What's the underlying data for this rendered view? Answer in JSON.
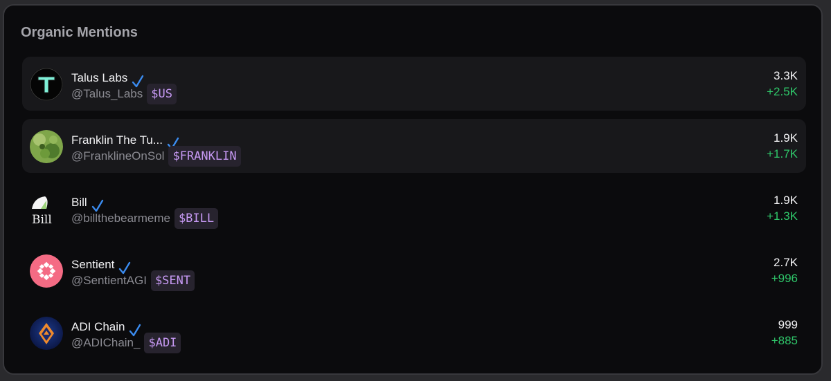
{
  "panel": {
    "title": "Organic Mentions"
  },
  "mentions": [
    {
      "name": "Talus Labs",
      "handle": "@Talus_Labs",
      "ticker": "$US",
      "count": "3.3K",
      "delta": "+2.5K",
      "avatar_icon": "talus-logo"
    },
    {
      "name": "Franklin The Tu...",
      "handle": "@FranklineOnSol",
      "ticker": "$FRANKLIN",
      "count": "1.9K",
      "delta": "+1.7K",
      "avatar_icon": "turtle-photo"
    },
    {
      "name": "Bill",
      "handle": "@billthebearmeme",
      "ticker": "$BILL",
      "count": "1.9K",
      "delta": "+1.3K",
      "avatar_icon": "bill-logo",
      "avatar_text": "Bill"
    },
    {
      "name": "Sentient",
      "handle": "@SentientAGI",
      "ticker": "$SENT",
      "count": "2.7K",
      "delta": "+996",
      "avatar_icon": "sentient-logo"
    },
    {
      "name": "ADI Chain",
      "handle": "@ADIChain_",
      "ticker": "$ADI",
      "count": "999",
      "delta": "+885",
      "avatar_icon": "adi-logo"
    }
  ],
  "colors": {
    "background": "#0b0b0d",
    "row_highlight": "#18181b",
    "ticker_text": "#c79af4",
    "ticker_bg": "#27232e",
    "delta_positive": "#2fc76a",
    "verified": "#3b8cf0"
  }
}
